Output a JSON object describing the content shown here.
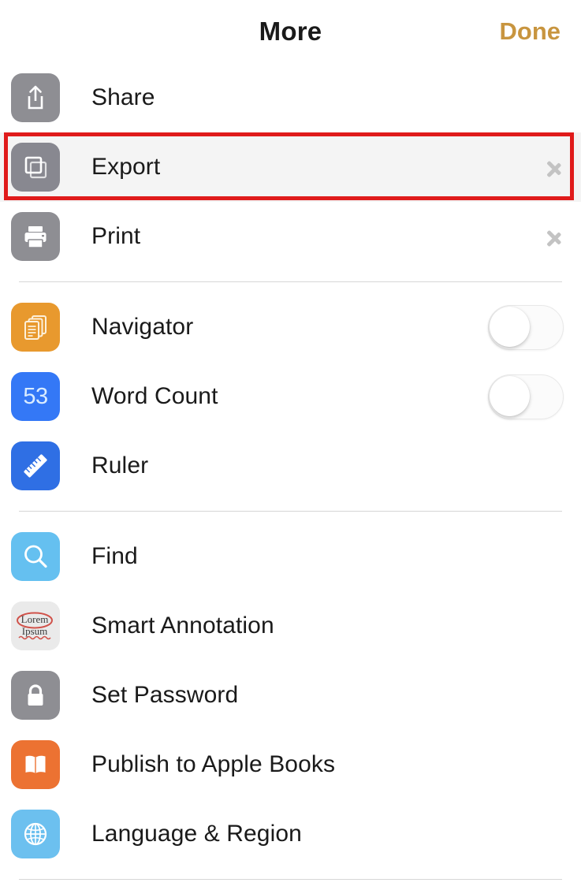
{
  "header": {
    "title": "More",
    "done_label": "Done"
  },
  "colors": {
    "accent_done": "#c8953f",
    "highlight_border": "#e01b1b",
    "highlight_row_bg": "#f4f4f4",
    "divider": "#d6d6d6",
    "icon_gray": "#8e8e93",
    "icon_orange": "#e8992e",
    "icon_blue": "#3478f6",
    "icon_blue_light": "#65c0f0",
    "icon_orange_books": "#ec7232"
  },
  "groups": [
    {
      "id": "group-document-actions",
      "rows": [
        {
          "id": "share",
          "label": "Share",
          "icon": "share-icon",
          "accessory": "none",
          "highlighted": false
        },
        {
          "id": "export",
          "label": "Export",
          "icon": "export-icon",
          "accessory": "chevron",
          "highlighted": true
        },
        {
          "id": "print",
          "label": "Print",
          "icon": "print-icon",
          "accessory": "chevron",
          "highlighted": false
        }
      ]
    },
    {
      "id": "group-view-options",
      "rows": [
        {
          "id": "navigator",
          "label": "Navigator",
          "icon": "navigator-icon",
          "accessory": "toggle",
          "toggle_state": "off",
          "highlighted": false
        },
        {
          "id": "word-count",
          "label": "Word Count",
          "icon": "word-count-icon",
          "accessory": "toggle",
          "toggle_state": "off",
          "highlighted": false,
          "badge_value": "53"
        },
        {
          "id": "ruler",
          "label": "Ruler",
          "icon": "ruler-icon",
          "accessory": "none",
          "highlighted": false
        }
      ]
    },
    {
      "id": "group-tools",
      "rows": [
        {
          "id": "find",
          "label": "Find",
          "icon": "search-icon",
          "accessory": "none",
          "highlighted": false
        },
        {
          "id": "smart-annotation",
          "label": "Smart Annotation",
          "icon": "smart-annotation-icon",
          "accessory": "none",
          "highlighted": false
        },
        {
          "id": "set-password",
          "label": "Set Password",
          "icon": "lock-icon",
          "accessory": "none",
          "highlighted": false
        },
        {
          "id": "publish-books",
          "label": "Publish to Apple Books",
          "icon": "book-icon",
          "accessory": "none",
          "highlighted": false
        },
        {
          "id": "language-region",
          "label": "Language & Region",
          "icon": "globe-icon",
          "accessory": "none",
          "highlighted": false
        }
      ]
    }
  ],
  "smart_annotation_icon_text": {
    "line1": "Lorem",
    "line2": "Ipsum"
  }
}
